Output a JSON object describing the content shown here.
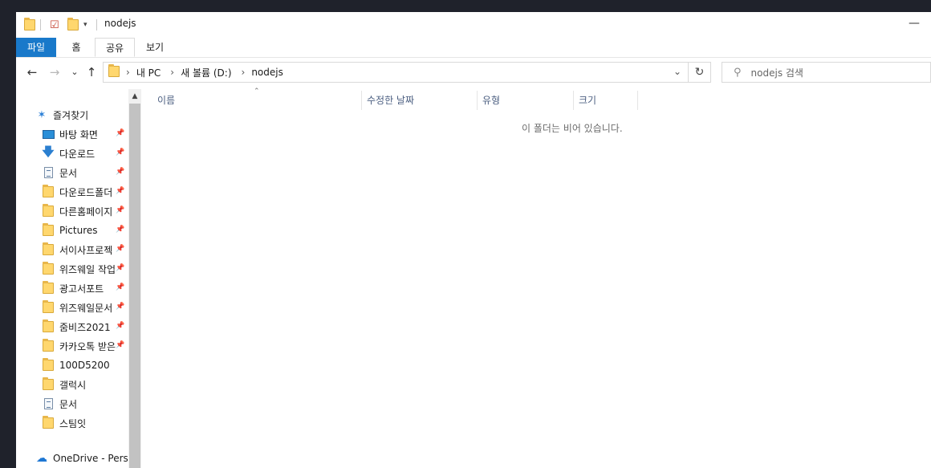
{
  "window": {
    "title": "nodejs",
    "minimize": "—"
  },
  "ribbon": {
    "tabs": [
      "파일",
      "홈",
      "공유",
      "보기"
    ],
    "active": "공유"
  },
  "navbar": {
    "back": "←",
    "forward": "→",
    "recent": "⌄",
    "up": "↑",
    "breadcrumb": [
      "내 PC",
      "새 볼륨 (D:)",
      "nodejs"
    ],
    "refresh": "↻",
    "search_placeholder": "nodejs 검색"
  },
  "navpane": {
    "quick_access": "즐겨찾기",
    "items": [
      {
        "label": "바탕 화면",
        "icon": "desktop-icon",
        "pinned": true
      },
      {
        "label": "다운로드",
        "icon": "download-icon",
        "pinned": true
      },
      {
        "label": "문서",
        "icon": "document-icon",
        "pinned": true
      },
      {
        "label": "다운로드폴더",
        "icon": "folder-icon",
        "pinned": true
      },
      {
        "label": "다른홈페이지",
        "icon": "folder-icon",
        "pinned": true
      },
      {
        "label": "Pictures",
        "icon": "folder-icon",
        "pinned": true
      },
      {
        "label": "서이사프로젝",
        "icon": "folder-icon",
        "pinned": true
      },
      {
        "label": "위즈웨일 작업",
        "icon": "folder-icon",
        "pinned": true
      },
      {
        "label": "광고서포트",
        "icon": "folder-icon",
        "pinned": true
      },
      {
        "label": "위즈웨일문서",
        "icon": "folder-icon",
        "pinned": true
      },
      {
        "label": "줌비즈2021",
        "icon": "folder-icon",
        "pinned": true
      },
      {
        "label": "카카오톡 받은",
        "icon": "folder-icon",
        "pinned": true
      },
      {
        "label": "100D5200",
        "icon": "folder-icon",
        "pinned": false
      },
      {
        "label": "갤럭시",
        "icon": "folder-icon",
        "pinned": false
      },
      {
        "label": "문서",
        "icon": "document-icon",
        "pinned": false
      },
      {
        "label": "스팀잇",
        "icon": "folder-icon",
        "pinned": false
      }
    ],
    "onedrive": "OneDrive - Perso"
  },
  "columns": [
    "이름",
    "수정한 날짜",
    "유형",
    "크기"
  ],
  "empty_message": "이 폴더는 비어 있습니다.",
  "colors": {
    "file_tab": "#1979ca",
    "folder": "#ffd76e",
    "accent": "#2a7fd6"
  }
}
